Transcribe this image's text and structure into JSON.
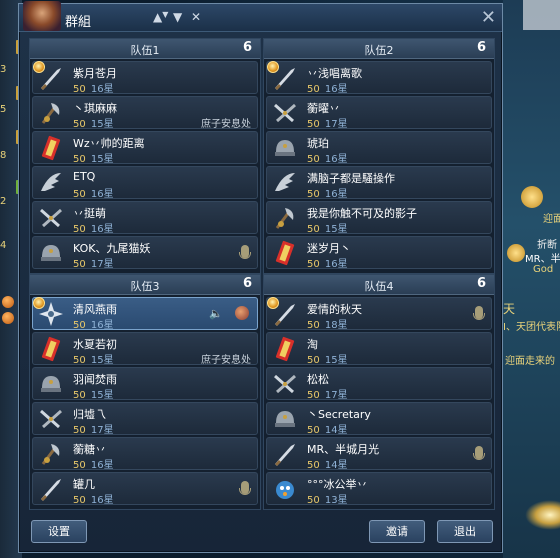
{
  "window": {
    "title": "群組",
    "close_glyph": "✕"
  },
  "left_strip": {
    "numbers": [
      "3",
      "5",
      "8",
      "2",
      "4"
    ]
  },
  "scene": {
    "texts": [
      "迎面",
      "折断",
      "MR、半",
      "God",
      "天",
      "I、天团代表队",
      "迎面走来的"
    ]
  },
  "teams": [
    {
      "title": "队伍1",
      "count": "6",
      "members": [
        {
          "name": "紫月苍月",
          "level": "50",
          "stars": "16星",
          "location": "",
          "icon": "sword-class-icon",
          "leader": true,
          "voice": false
        },
        {
          "name": "丶琪麻麻",
          "level": "50",
          "stars": "15星",
          "location": "庶子安息处",
          "icon": "axe-class-icon",
          "leader": false,
          "voice": false
        },
        {
          "name": "Wz丷帅的距离",
          "level": "50",
          "stars": "15星",
          "location": "",
          "icon": "talisman-class-icon",
          "leader": false,
          "voice": false
        },
        {
          "name": "ETQ",
          "level": "50",
          "stars": "16星",
          "location": "",
          "icon": "claw-class-icon",
          "leader": false,
          "voice": false
        },
        {
          "name": "丷挺萌",
          "level": "50",
          "stars": "16星",
          "location": "",
          "icon": "dual-blade-class-icon",
          "leader": false,
          "voice": false
        },
        {
          "name": "KOK、九尾猫妖",
          "level": "50",
          "stars": "17星",
          "location": "",
          "icon": "helmet-class-icon",
          "leader": false,
          "voice": true
        }
      ]
    },
    {
      "title": "队伍2",
      "count": "6",
      "members": [
        {
          "name": "丷浅唱离歌",
          "level": "50",
          "stars": "16星",
          "location": "",
          "icon": "sword-class-icon",
          "leader": true,
          "voice": false
        },
        {
          "name": "蘅曜丷",
          "level": "50",
          "stars": "17星",
          "location": "",
          "icon": "dual-blade-class-icon",
          "leader": false,
          "voice": false
        },
        {
          "name": "琥珀",
          "level": "50",
          "stars": "16星",
          "location": "",
          "icon": "helmet-class-icon",
          "leader": false,
          "voice": false
        },
        {
          "name": "满脑子都是騷操作",
          "level": "50",
          "stars": "16星",
          "location": "",
          "icon": "claw-class-icon",
          "leader": false,
          "voice": false
        },
        {
          "name": "我是你触不可及的影子",
          "level": "50",
          "stars": "15星",
          "location": "",
          "icon": "axe-class-icon",
          "leader": false,
          "voice": false
        },
        {
          "name": "迷岁月丶",
          "level": "50",
          "stars": "16星",
          "location": "",
          "icon": "talisman-class-icon",
          "leader": false,
          "voice": false
        }
      ]
    },
    {
      "title": "队伍3",
      "count": "6",
      "members": [
        {
          "name": "清风燕雨",
          "level": "50",
          "stars": "16星",
          "location": "",
          "icon": "shuriken-class-icon",
          "leader": true,
          "voice": false,
          "selected": true,
          "speaking": true
        },
        {
          "name": "水夏若初",
          "level": "50",
          "stars": "15星",
          "location": "庶子安息处",
          "icon": "talisman-class-icon",
          "leader": false,
          "voice": false
        },
        {
          "name": "羽闻焚雨",
          "level": "50",
          "stars": "15星",
          "location": "",
          "icon": "helmet-class-icon",
          "leader": false,
          "voice": false
        },
        {
          "name": "归墟乁",
          "level": "50",
          "stars": "17星",
          "location": "",
          "icon": "dual-blade-class-icon",
          "leader": false,
          "voice": false
        },
        {
          "name": "蘅糖丷",
          "level": "50",
          "stars": "16星",
          "location": "",
          "icon": "axe-class-icon",
          "leader": false,
          "voice": false
        },
        {
          "name": "罐几",
          "level": "50",
          "stars": "16星",
          "location": "",
          "icon": "sword-class-icon",
          "leader": false,
          "voice": true
        }
      ]
    },
    {
      "title": "队伍4",
      "count": "6",
      "members": [
        {
          "name": "爱情的秋天",
          "level": "50",
          "stars": "18星",
          "location": "",
          "icon": "sword-class-icon",
          "leader": true,
          "voice": true
        },
        {
          "name": "淘",
          "level": "50",
          "stars": "15星",
          "location": "",
          "icon": "talisman-class-icon",
          "leader": false,
          "voice": false
        },
        {
          "name": "松松",
          "level": "50",
          "stars": "17星",
          "location": "",
          "icon": "dual-blade-class-icon",
          "leader": false,
          "voice": false
        },
        {
          "name": "丶Secretary",
          "level": "50",
          "stars": "14星",
          "location": "",
          "icon": "helmet-class-icon",
          "leader": false,
          "voice": false
        },
        {
          "name": "MR、半城月光",
          "level": "50",
          "stars": "14星",
          "location": "",
          "icon": "sword-class-icon",
          "leader": false,
          "voice": true
        },
        {
          "name": "°°°冰公举丷",
          "level": "50",
          "stars": "13星",
          "location": "",
          "icon": "pet-class-icon",
          "leader": false,
          "voice": false
        }
      ]
    }
  ],
  "buttons": {
    "settings": "设置",
    "invite": "邀请",
    "exit": "退出"
  },
  "colors": {
    "level": "#e8c86a",
    "panel": "#14202f",
    "selected": "#3a5d86"
  }
}
